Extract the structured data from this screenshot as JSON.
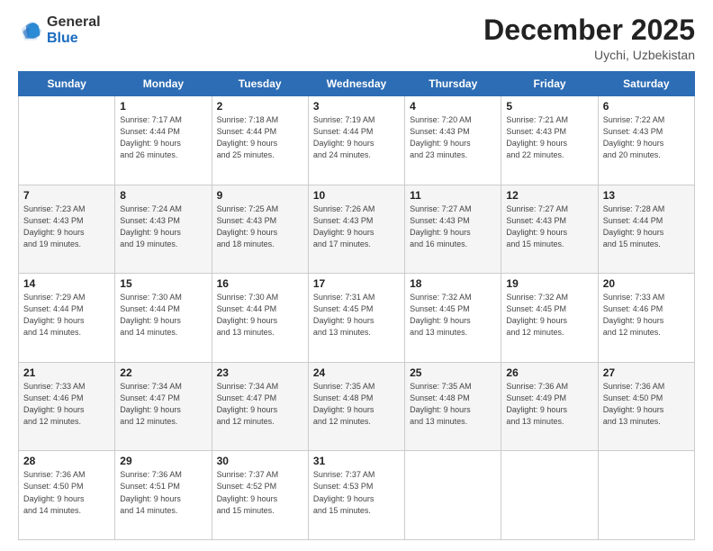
{
  "logo": {
    "general": "General",
    "blue": "Blue"
  },
  "header": {
    "title": "December 2025",
    "location": "Uychi, Uzbekistan"
  },
  "weekdays": [
    "Sunday",
    "Monday",
    "Tuesday",
    "Wednesday",
    "Thursday",
    "Friday",
    "Saturday"
  ],
  "weeks": [
    [
      {
        "day": "",
        "sunrise": "",
        "sunset": "",
        "daylight": ""
      },
      {
        "day": "1",
        "sunrise": "Sunrise: 7:17 AM",
        "sunset": "Sunset: 4:44 PM",
        "daylight": "Daylight: 9 hours and 26 minutes."
      },
      {
        "day": "2",
        "sunrise": "Sunrise: 7:18 AM",
        "sunset": "Sunset: 4:44 PM",
        "daylight": "Daylight: 9 hours and 25 minutes."
      },
      {
        "day": "3",
        "sunrise": "Sunrise: 7:19 AM",
        "sunset": "Sunset: 4:44 PM",
        "daylight": "Daylight: 9 hours and 24 minutes."
      },
      {
        "day": "4",
        "sunrise": "Sunrise: 7:20 AM",
        "sunset": "Sunset: 4:43 PM",
        "daylight": "Daylight: 9 hours and 23 minutes."
      },
      {
        "day": "5",
        "sunrise": "Sunrise: 7:21 AM",
        "sunset": "Sunset: 4:43 PM",
        "daylight": "Daylight: 9 hours and 22 minutes."
      },
      {
        "day": "6",
        "sunrise": "Sunrise: 7:22 AM",
        "sunset": "Sunset: 4:43 PM",
        "daylight": "Daylight: 9 hours and 20 minutes."
      }
    ],
    [
      {
        "day": "7",
        "sunrise": "Sunrise: 7:23 AM",
        "sunset": "Sunset: 4:43 PM",
        "daylight": "Daylight: 9 hours and 19 minutes."
      },
      {
        "day": "8",
        "sunrise": "Sunrise: 7:24 AM",
        "sunset": "Sunset: 4:43 PM",
        "daylight": "Daylight: 9 hours and 19 minutes."
      },
      {
        "day": "9",
        "sunrise": "Sunrise: 7:25 AM",
        "sunset": "Sunset: 4:43 PM",
        "daylight": "Daylight: 9 hours and 18 minutes."
      },
      {
        "day": "10",
        "sunrise": "Sunrise: 7:26 AM",
        "sunset": "Sunset: 4:43 PM",
        "daylight": "Daylight: 9 hours and 17 minutes."
      },
      {
        "day": "11",
        "sunrise": "Sunrise: 7:27 AM",
        "sunset": "Sunset: 4:43 PM",
        "daylight": "Daylight: 9 hours and 16 minutes."
      },
      {
        "day": "12",
        "sunrise": "Sunrise: 7:27 AM",
        "sunset": "Sunset: 4:43 PM",
        "daylight": "Daylight: 9 hours and 15 minutes."
      },
      {
        "day": "13",
        "sunrise": "Sunrise: 7:28 AM",
        "sunset": "Sunset: 4:44 PM",
        "daylight": "Daylight: 9 hours and 15 minutes."
      }
    ],
    [
      {
        "day": "14",
        "sunrise": "Sunrise: 7:29 AM",
        "sunset": "Sunset: 4:44 PM",
        "daylight": "Daylight: 9 hours and 14 minutes."
      },
      {
        "day": "15",
        "sunrise": "Sunrise: 7:30 AM",
        "sunset": "Sunset: 4:44 PM",
        "daylight": "Daylight: 9 hours and 14 minutes."
      },
      {
        "day": "16",
        "sunrise": "Sunrise: 7:30 AM",
        "sunset": "Sunset: 4:44 PM",
        "daylight": "Daylight: 9 hours and 13 minutes."
      },
      {
        "day": "17",
        "sunrise": "Sunrise: 7:31 AM",
        "sunset": "Sunset: 4:45 PM",
        "daylight": "Daylight: 9 hours and 13 minutes."
      },
      {
        "day": "18",
        "sunrise": "Sunrise: 7:32 AM",
        "sunset": "Sunset: 4:45 PM",
        "daylight": "Daylight: 9 hours and 13 minutes."
      },
      {
        "day": "19",
        "sunrise": "Sunrise: 7:32 AM",
        "sunset": "Sunset: 4:45 PM",
        "daylight": "Daylight: 9 hours and 12 minutes."
      },
      {
        "day": "20",
        "sunrise": "Sunrise: 7:33 AM",
        "sunset": "Sunset: 4:46 PM",
        "daylight": "Daylight: 9 hours and 12 minutes."
      }
    ],
    [
      {
        "day": "21",
        "sunrise": "Sunrise: 7:33 AM",
        "sunset": "Sunset: 4:46 PM",
        "daylight": "Daylight: 9 hours and 12 minutes."
      },
      {
        "day": "22",
        "sunrise": "Sunrise: 7:34 AM",
        "sunset": "Sunset: 4:47 PM",
        "daylight": "Daylight: 9 hours and 12 minutes."
      },
      {
        "day": "23",
        "sunrise": "Sunrise: 7:34 AM",
        "sunset": "Sunset: 4:47 PM",
        "daylight": "Daylight: 9 hours and 12 minutes."
      },
      {
        "day": "24",
        "sunrise": "Sunrise: 7:35 AM",
        "sunset": "Sunset: 4:48 PM",
        "daylight": "Daylight: 9 hours and 12 minutes."
      },
      {
        "day": "25",
        "sunrise": "Sunrise: 7:35 AM",
        "sunset": "Sunset: 4:48 PM",
        "daylight": "Daylight: 9 hours and 13 minutes."
      },
      {
        "day": "26",
        "sunrise": "Sunrise: 7:36 AM",
        "sunset": "Sunset: 4:49 PM",
        "daylight": "Daylight: 9 hours and 13 minutes."
      },
      {
        "day": "27",
        "sunrise": "Sunrise: 7:36 AM",
        "sunset": "Sunset: 4:50 PM",
        "daylight": "Daylight: 9 hours and 13 minutes."
      }
    ],
    [
      {
        "day": "28",
        "sunrise": "Sunrise: 7:36 AM",
        "sunset": "Sunset: 4:50 PM",
        "daylight": "Daylight: 9 hours and 14 minutes."
      },
      {
        "day": "29",
        "sunrise": "Sunrise: 7:36 AM",
        "sunset": "Sunset: 4:51 PM",
        "daylight": "Daylight: 9 hours and 14 minutes."
      },
      {
        "day": "30",
        "sunrise": "Sunrise: 7:37 AM",
        "sunset": "Sunset: 4:52 PM",
        "daylight": "Daylight: 9 hours and 15 minutes."
      },
      {
        "day": "31",
        "sunrise": "Sunrise: 7:37 AM",
        "sunset": "Sunset: 4:53 PM",
        "daylight": "Daylight: 9 hours and 15 minutes."
      },
      {
        "day": "",
        "sunrise": "",
        "sunset": "",
        "daylight": ""
      },
      {
        "day": "",
        "sunrise": "",
        "sunset": "",
        "daylight": ""
      },
      {
        "day": "",
        "sunrise": "",
        "sunset": "",
        "daylight": ""
      }
    ]
  ]
}
